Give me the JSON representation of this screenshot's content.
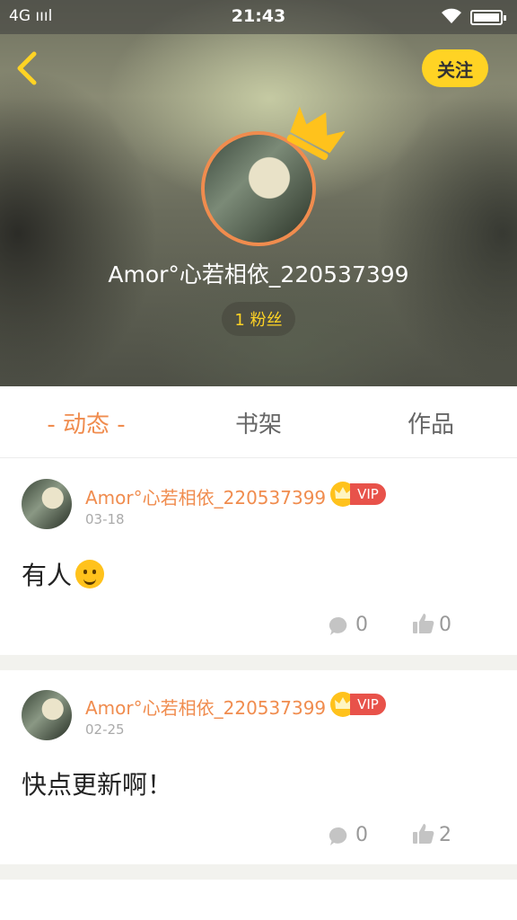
{
  "status_bar": {
    "network": "4G",
    "time": "21:43"
  },
  "header": {
    "follow_label": "关注",
    "username": "Amor°心若相依_220537399",
    "fans_label": "1 粉丝"
  },
  "tabs": [
    {
      "label": "- 动态 -",
      "active": true
    },
    {
      "label": "书架",
      "active": false
    },
    {
      "label": "作品",
      "active": false
    }
  ],
  "posts": [
    {
      "author": "Amor°心若相依_220537399",
      "vip_label": "VIP",
      "date": "03-18",
      "content": "有人",
      "has_emoji": true,
      "comments": "0",
      "likes": "0"
    },
    {
      "author": "Amor°心若相依_220537399",
      "vip_label": "VIP",
      "date": "02-25",
      "content": "快点更新啊！",
      "has_emoji": false,
      "comments": "0",
      "likes": "2"
    }
  ],
  "colors": {
    "accent_orange": "#f08c4e",
    "follow_yellow": "#ffd324",
    "vip_red": "#e8524a"
  }
}
